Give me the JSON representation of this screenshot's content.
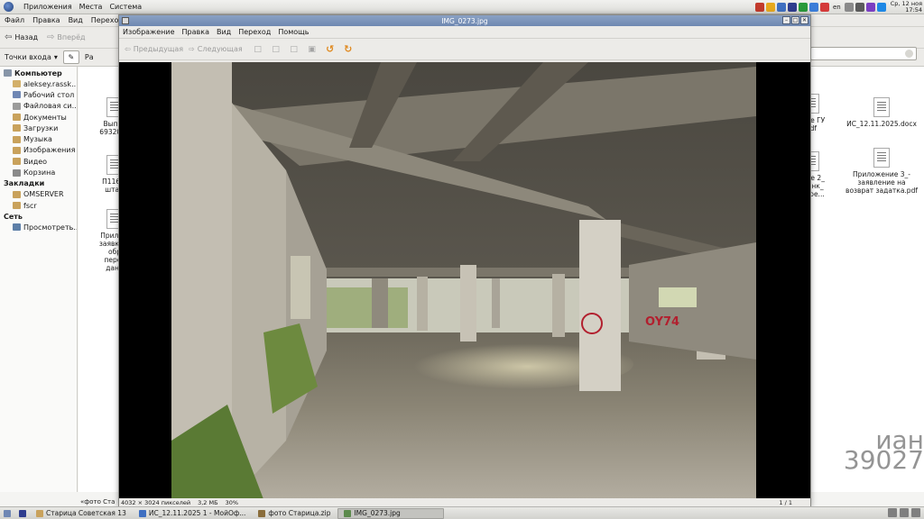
{
  "top_panel": {
    "menu": [
      "Приложения",
      "Места",
      "Система"
    ],
    "keyboard_layout": "en",
    "clock_day": "Ср, 12 ноя",
    "clock_time": "17:54"
  },
  "file_manager": {
    "menu": [
      "Файл",
      "Правка",
      "Вид",
      "Переход",
      "За"
    ],
    "toolbar": {
      "back": "Назад",
      "forward": "Вперёд"
    },
    "places_dropdown": "Точки входа",
    "path_fragment": "Ра",
    "sidebar": {
      "computer_header": "Компьютер",
      "computer_items": [
        {
          "label": "aleksey.rassk...",
          "icon": "home-folder-icon"
        },
        {
          "label": "Рабочий стол",
          "icon": "desktop-icon"
        },
        {
          "label": "Файловая си...",
          "icon": "drive-icon"
        },
        {
          "label": "Документы",
          "icon": "folder-icon"
        },
        {
          "label": "Загрузки",
          "icon": "folder-icon"
        },
        {
          "label": "Музыка",
          "icon": "folder-icon"
        },
        {
          "label": "Изображения",
          "icon": "folder-icon"
        },
        {
          "label": "Видео",
          "icon": "folder-icon"
        },
        {
          "label": "Корзина",
          "icon": "trash-icon"
        }
      ],
      "bookmarks_header": "Закладки",
      "bookmark_items": [
        {
          "label": "OMSERVER",
          "icon": "folder-icon"
        },
        {
          "label": "fscr",
          "icon": "folder-icon"
        }
      ],
      "network_header": "Сеть",
      "network_items": [
        {
          "label": "Просмотреть...",
          "icon": "network-icon"
        }
      ]
    },
    "files_left": [
      {
        "lines": [
          "Выпис",
          "6932032"
        ]
      },
      {
        "lines": [
          "П1169(",
          "штам"
        ]
      },
      {
        "lines": [
          "Прилож",
          "заявке С",
          "обр",
          "персо",
          "данн"
        ]
      }
    ],
    "files_right": [
      {
        "lines": [
          "ение ГУ",
          "pdf"
        ]
      },
      {
        "lines": [
          "ИС_12.11.2025.docx"
        ]
      },
      {
        "lines": [
          "ение 2_",
          "бланк_",
          "ые ре..."
        ]
      },
      {
        "lines": [
          "Приложение 3_-",
          "заявление на",
          "возврат задатка.pdf"
        ]
      }
    ],
    "watermark": [
      "иан",
      "39027"
    ],
    "status_fragment": "«фото Ста"
  },
  "viewer": {
    "title": "IMG_0273.jpg",
    "menu": [
      "Изображение",
      "Правка",
      "Вид",
      "Переход",
      "Помощь"
    ],
    "toolbar": {
      "prev": "Предыдущая",
      "next": "Следующая"
    },
    "status": {
      "dimensions": "4032 × 3024 пикселей",
      "size": "3,2 МБ",
      "zoom": "30%",
      "page": "1 / 1"
    },
    "graffiti": "OY74"
  },
  "taskbar": {
    "tasks": [
      {
        "label": "Старица Советская 13",
        "icon": "folder-icon",
        "active": false
      },
      {
        "label": "ИС_12.11.2025 1 - МойОф...",
        "icon": "document-icon",
        "active": false
      },
      {
        "label": "фото Старица.zip",
        "icon": "archive-icon",
        "active": false
      },
      {
        "label": "IMG_0273.jpg",
        "icon": "image-icon",
        "active": true
      }
    ]
  }
}
